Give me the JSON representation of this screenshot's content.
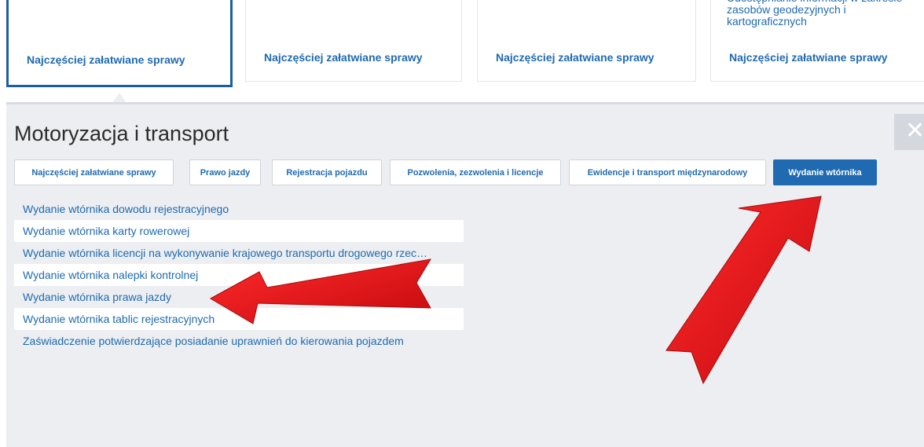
{
  "cards": {
    "card4_top_text": "Udostępnianie informacji w zakresie zasobów geodezyjnych i kartograficznych",
    "links": [
      "Najczęściej załatwiane sprawy",
      "Najczęściej załatwiane sprawy",
      "Najczęściej załatwiane sprawy",
      "Najczęściej załatwiane sprawy"
    ]
  },
  "panel": {
    "title": "Motoryzacja i transport",
    "close_icon": "✕",
    "tabs": [
      {
        "label": "Najczęściej załatwiane sprawy",
        "active": false
      },
      {
        "label": "Prawo jazdy",
        "active": false
      },
      {
        "label": "Rejestracja pojazdu",
        "active": false
      },
      {
        "label": "Pozwolenia, zezwolenia i licencje",
        "active": false
      },
      {
        "label": "Ewidencje i transport międzynarodowy",
        "active": false
      },
      {
        "label": "Wydanie wtórnika",
        "active": true
      }
    ],
    "items": [
      "Wydanie wtórnika dowodu rejestracyjnego",
      "Wydanie wtórnika karty rowerowej",
      "Wydanie wtórnika licencji na wykonywanie krajowego transportu drogowego rzec…",
      "Wydanie wtórnika nalepki kontrolnej",
      "Wydanie wtórnika prawa jazdy",
      "Wydanie wtórnika tablic rejestracyjnych",
      "Zaświadczenie potwierdzające posiadanie uprawnień do kierowania pojazdem"
    ]
  },
  "annotations": {
    "arrow_color": "#e8141a"
  }
}
